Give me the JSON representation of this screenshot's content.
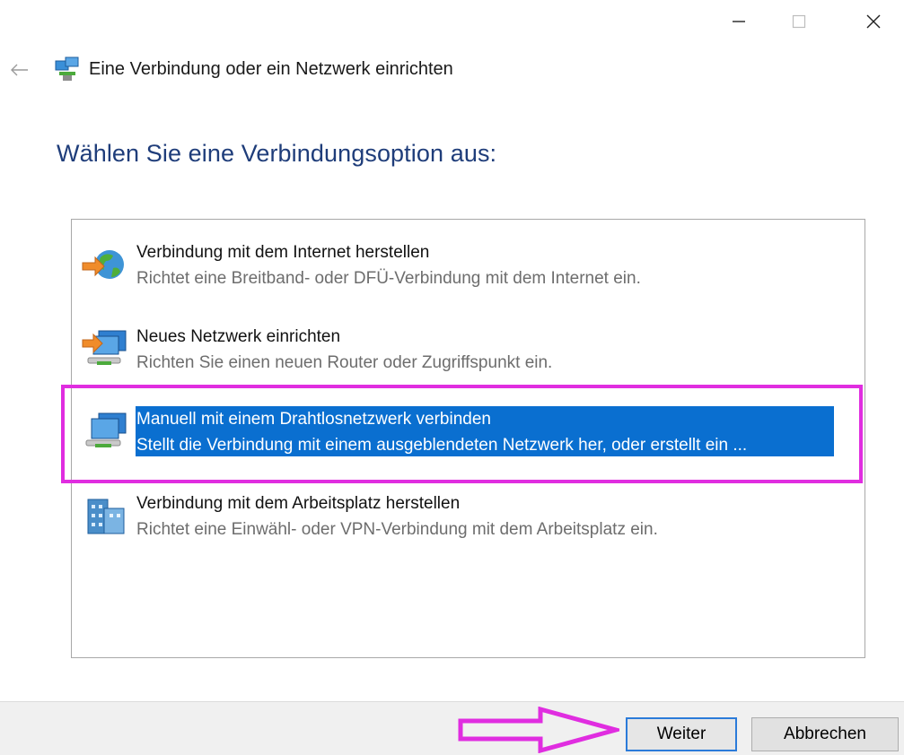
{
  "window": {
    "title": "Eine Verbindung oder ein Netzwerk einrichten",
    "controls": [
      "minimize-icon",
      "maximize-icon",
      "close-icon"
    ]
  },
  "page": {
    "heading": "Wählen Sie eine Verbindungsoption aus:"
  },
  "options": [
    {
      "title": "Verbindung mit dem Internet herstellen",
      "description": "Richtet eine Breitband- oder DFÜ-Verbindung mit dem Internet ein.",
      "icon": "globe-arrow-icon",
      "selected": false
    },
    {
      "title": "Neues Netzwerk einrichten",
      "description": "Richten Sie einen neuen Router oder Zugriffspunkt ein.",
      "icon": "new-network-icon",
      "selected": false
    },
    {
      "title": "Manuell mit einem Drahtlosnetzwerk verbinden",
      "description": "Stellt die Verbindung mit einem ausgeblendeten Netzwerk her, oder erstellt ein ...",
      "icon": "wireless-network-icon",
      "selected": true
    },
    {
      "title": "Verbindung mit dem Arbeitsplatz herstellen",
      "description": "Richtet eine Einwähl- oder VPN-Verbindung mit dem Arbeitsplatz ein.",
      "icon": "workplace-building-icon",
      "selected": false
    }
  ],
  "buttons": {
    "next": "Weiter",
    "cancel": "Abbrechen"
  },
  "colors": {
    "heading": "#1f3d7a",
    "selection": "#0a6fd0",
    "annotation": "#e02de0"
  }
}
